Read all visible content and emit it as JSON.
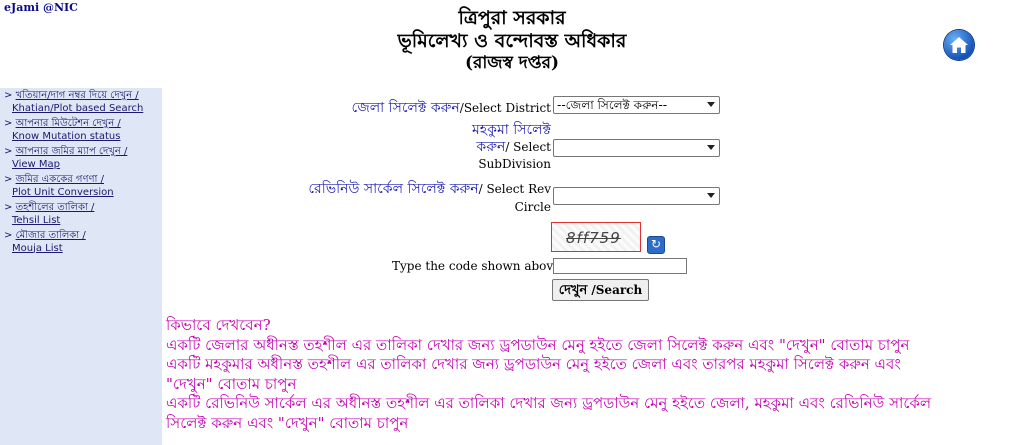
{
  "brand": "eJami @NIC",
  "header": {
    "line1": "ত্রিপুরা সরকার",
    "line2": "ভূমিলেখ্য ও বন্দোবস্ত অধিকার",
    "line3": "(রাজস্ব দপ্তর)"
  },
  "nav": [
    {
      "marker": ">",
      "line1": "খতিয়ান/দাগ নম্বর দিয়ে দেখুন /",
      "line2": "Khatian/Plot based Search"
    },
    {
      "marker": ">",
      "line1": "আপনার মিউটেশন দেখুন /",
      "line2": "Know Mutation status"
    },
    {
      "marker": ">",
      "line1": "আপনার জমির ম্যাপ দেখুন /",
      "line2": "View Map"
    },
    {
      "marker": ">",
      "line1": "জমির এককের গণণা /",
      "line2": "Plot Unit Conversion"
    },
    {
      "marker": ">",
      "line1": "তহশীলের তালিকা /",
      "line2": "Tehsil List"
    },
    {
      "marker": ">",
      "line1": "মৌজার তালিকা /",
      "line2": "Mouja List"
    }
  ],
  "form": {
    "district_label_bn": "জেলা সিলেক্ট করুন",
    "district_label_en": "/Select District",
    "district_value": "--জেলা সিলেক্ট করুন--",
    "subdivision_label_bn1": "মহকুমা সিলেক্ট",
    "subdivision_label_bn2": "করুন",
    "subdivision_label_en1": "/ Select",
    "subdivision_label_en2": "SubDivision",
    "subdivision_value": "",
    "circle_label_bn": "রেভিনিউ সার্কেল সিলেক্ট করুন",
    "circle_label_en1": "/ Select Rev",
    "circle_label_en2": "Circle",
    "circle_value": "",
    "captcha_text": "8ff759",
    "refresh_glyph": "↻",
    "code_label": "Type the code shown above",
    "code_value": "",
    "search_bn": "দেখুন",
    "search_en": " /Search"
  },
  "help": {
    "title": "কিভাবে দেখবেন?",
    "lines": [
      "একটি জেলার অধীনস্ত তহশীল এর তালিকা দেখার জন্য ড্রপডাউন মেনু হইতে জেলা সিলেক্ট করুন এবং \"দেখুন\" বোতাম চাপুন",
      "একটি মহকুমার অধীনস্ত তহশীল এর তালিকা দেখার জন্য ড্রপডাউন মেনু হইতে জেলা এবং তারপর মহকুমা সিলেক্ট করুন এবং",
      "\"দেখুন\" বোতাম চাপুন",
      "একটি রেভিনিউ সার্কেল এর অধীনস্ত তহশীল এর তালিকা দেখার জন্য ড্রপডাউন মেনু হইতে জেলা, মহকুমা এবং রেভিনিউ সার্কেল",
      "সিলেক্ট করুন এবং \"দেখুন\" বোতাম চাপুন"
    ]
  },
  "colors": {
    "help_text": "#c000b0",
    "sidebar_bg": "#dfe6f6",
    "bengali_label": "#1c1cb0"
  },
  "icons": {
    "home": "home-icon",
    "refresh": "refresh-icon"
  }
}
